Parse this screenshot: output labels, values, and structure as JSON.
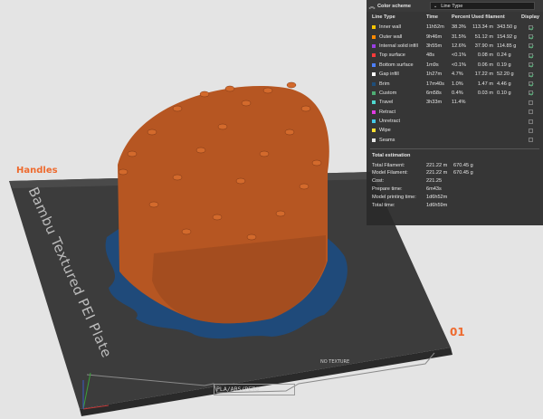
{
  "viewport": {
    "handles_label": "Handles",
    "plate_label": "Bambu Textured PEI Plate",
    "plate_number": "01",
    "plate_footer": "PLA/ABS/PETG",
    "plate_footer_side": "NO TEXTURE"
  },
  "panel": {
    "title": "Color scheme",
    "dropdown_value": "Line Type",
    "headers": {
      "type": "Line Type",
      "time": "Time",
      "percent": "Percent",
      "used": "Used filament",
      "display": "Display"
    },
    "rows": [
      {
        "label": "Inner wall",
        "time": "11h52m",
        "pct": "38.3%",
        "len": "113.34 m",
        "g": "343.50 g",
        "color": "#f7c500",
        "display": true
      },
      {
        "label": "Outer wall",
        "time": "9h46m",
        "pct": "31.5%",
        "len": "51.12 m",
        "g": "154.92 g",
        "color": "#ff8a00",
        "display": true
      },
      {
        "label": "Internal solid infill",
        "time": "3h55m",
        "pct": "12.6%",
        "len": "37.90 m",
        "g": "114.85 g",
        "color": "#9a3fe4",
        "display": true
      },
      {
        "label": "Top surface",
        "time": "48s",
        "pct": "<0.1%",
        "len": "0.08 m",
        "g": "0.24 g",
        "color": "#ff3a3a",
        "display": true
      },
      {
        "label": "Bottom surface",
        "time": "1m9s",
        "pct": "<0.1%",
        "len": "0.06 m",
        "g": "0.19 g",
        "color": "#4d80ff",
        "display": true
      },
      {
        "label": "Gap infill",
        "time": "1h27m",
        "pct": "4.7%",
        "len": "17.22 m",
        "g": "52.20 g",
        "color": "#ffffff",
        "display": true
      },
      {
        "label": "Brim",
        "time": "17m40s",
        "pct": "1.0%",
        "len": "1.47 m",
        "g": "4.46 g",
        "color": "#1e4e7a",
        "display": true
      },
      {
        "label": "Custom",
        "time": "6m58s",
        "pct": "0.4%",
        "len": "0.03 m",
        "g": "0.10 g",
        "color": "#4fae74",
        "display": true
      },
      {
        "label": "Travel",
        "time": "3h33m",
        "pct": "11.4%",
        "len": "",
        "g": "",
        "color": "#4fd9d0",
        "display": false
      },
      {
        "label": "Retract",
        "time": "",
        "pct": "",
        "len": "",
        "g": "",
        "color": "#e23be2",
        "display": false
      },
      {
        "label": "Unretract",
        "time": "",
        "pct": "",
        "len": "",
        "g": "",
        "color": "#45c9e8",
        "display": false
      },
      {
        "label": "Wipe",
        "time": "",
        "pct": "",
        "len": "",
        "g": "",
        "color": "#ffe033",
        "display": false
      },
      {
        "label": "Seams",
        "time": "",
        "pct": "",
        "len": "",
        "g": "",
        "color": "#e6e6e6",
        "display": false
      }
    ],
    "totals_title": "Total estimation",
    "totals": [
      {
        "k": "Total Filament:",
        "v1": "221.22 m",
        "v2": "670.45 g"
      },
      {
        "k": "Model Filament:",
        "v1": "221.22 m",
        "v2": "670.45 g"
      },
      {
        "k": "Cost:",
        "v1": "221.25",
        "v2": ""
      },
      {
        "k": "Prepare time:",
        "v1": "6m43s",
        "v2": ""
      },
      {
        "k": "Model printing time:",
        "v1": "1d6h52m",
        "v2": ""
      },
      {
        "k": "Total time:",
        "v1": "1d6h59m",
        "v2": ""
      }
    ]
  }
}
